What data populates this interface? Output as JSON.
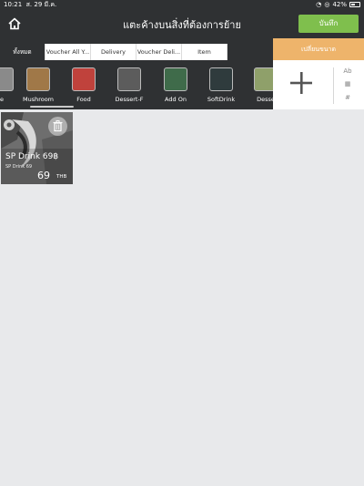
{
  "status_bar": {
    "time": "10:21",
    "date": "ส. 29 มี.ค.",
    "battery": "42%"
  },
  "navbar": {
    "title": "แตะค้างบนสิ่งที่ต้องการย้าย",
    "save_label": "บันทึก"
  },
  "tabs": [
    {
      "label": "ทั้งหมด",
      "active": true
    },
    {
      "label": "Voucher All Y...",
      "active": false
    },
    {
      "label": "Delivery",
      "active": false
    },
    {
      "label": "Voucher Deli...",
      "active": false
    },
    {
      "label": "Item",
      "active": false
    }
  ],
  "categories": [
    {
      "label": "e",
      "thumb": "#8a8a8a"
    },
    {
      "label": "Mushroom",
      "thumb": "#a07848"
    },
    {
      "label": "Food",
      "thumb": "#c0423c"
    },
    {
      "label": "Dessert-F",
      "thumb": "#5c5c5c"
    },
    {
      "label": "Add On",
      "thumb": "#3f6b4a"
    },
    {
      "label": "SoftDrink",
      "thumb": "#2f3b3d"
    },
    {
      "label": "Desse",
      "thumb": "#8fa06a"
    }
  ],
  "resize_panel": {
    "title": "เปลี่ยนขนาด",
    "options": [
      "Ab",
      "▦",
      "#"
    ]
  },
  "items": [
    {
      "name": "SP Drink 69฿",
      "subtitle": "SP Drink 69",
      "price": "69",
      "currency": "THB"
    }
  ],
  "colors": {
    "header": "#2f3133",
    "save_button": "#7fbf4d",
    "panel_header": "#eeb46b",
    "background": "#e8e9eb"
  }
}
